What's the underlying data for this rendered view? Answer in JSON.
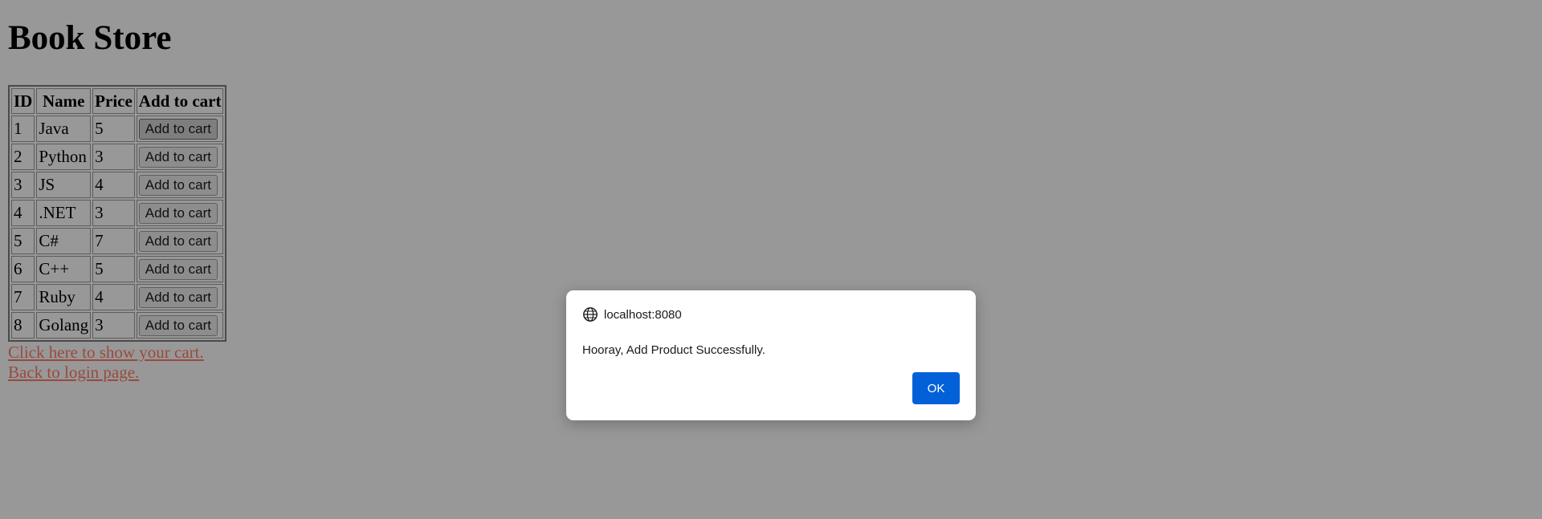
{
  "page": {
    "title": "Book Store"
  },
  "table": {
    "headers": [
      "ID",
      "Name",
      "Price",
      "Add to cart"
    ],
    "rows": [
      {
        "id": "1",
        "name": "Java",
        "price": "5",
        "button": "Add to cart"
      },
      {
        "id": "2",
        "name": "Python",
        "price": "3",
        "button": "Add to cart"
      },
      {
        "id": "3",
        "name": "JS",
        "price": "4",
        "button": "Add to cart"
      },
      {
        "id": "4",
        "name": ".NET",
        "price": "3",
        "button": "Add to cart"
      },
      {
        "id": "5",
        "name": "C#",
        "price": "7",
        "button": "Add to cart"
      },
      {
        "id": "6",
        "name": "C++",
        "price": "5",
        "button": "Add to cart"
      },
      {
        "id": "7",
        "name": "Ruby",
        "price": "4",
        "button": "Add to cart"
      },
      {
        "id": "8",
        "name": "Golang",
        "price": "3",
        "button": "Add to cart"
      }
    ]
  },
  "links": {
    "show_cart": "Click here to show your cart.",
    "back_login": "Back to login page."
  },
  "dialog": {
    "origin": "localhost:8080",
    "origin_icon": "globe-icon",
    "message": "Hooray, Add Product Successfully.",
    "ok_label": "OK"
  },
  "colors": {
    "overlay_background": "#989899",
    "ok_button": "#0260d8",
    "link": "#9a4a3c"
  }
}
